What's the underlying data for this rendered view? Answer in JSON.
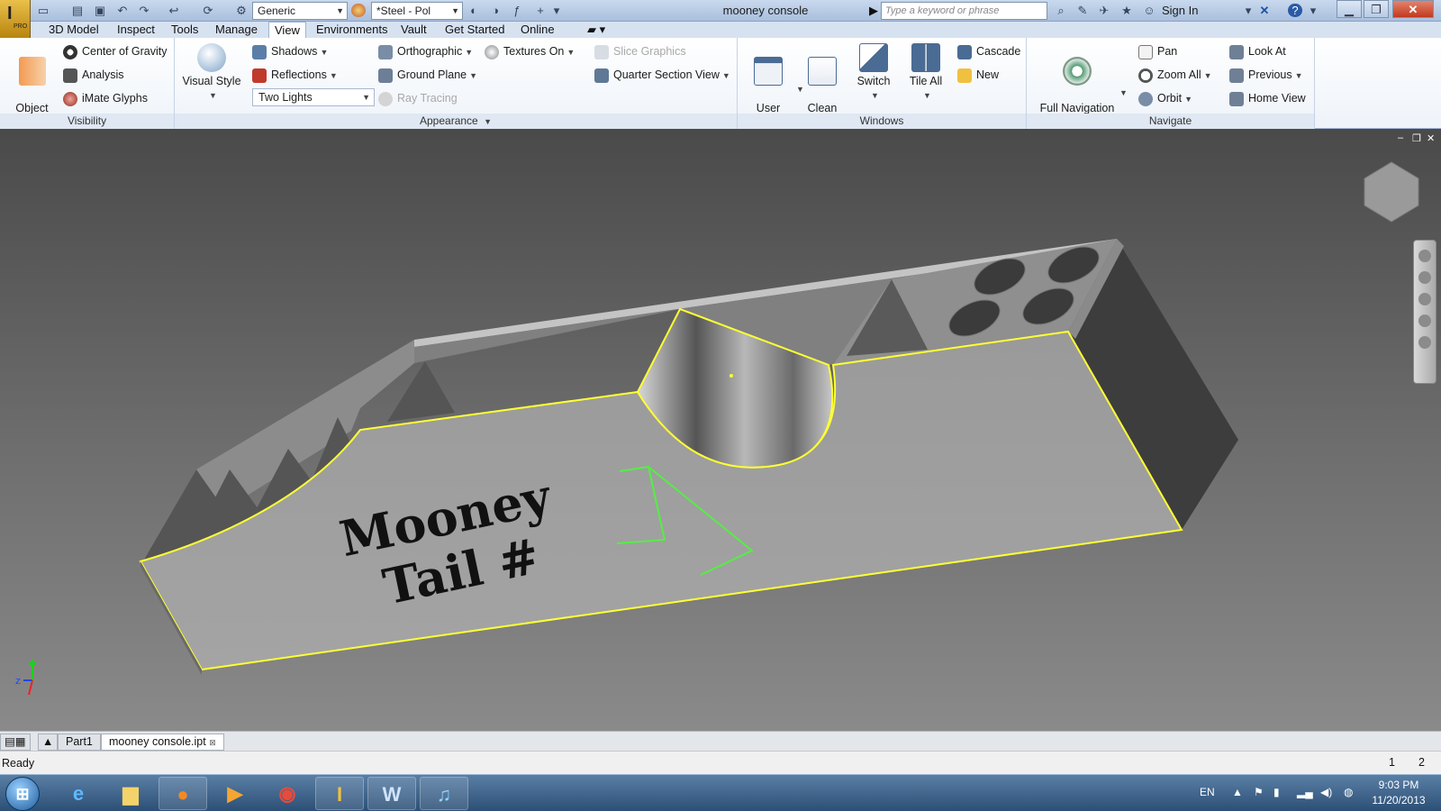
{
  "titlebar": {
    "style_combo": "Generic",
    "material_combo": "*Steel - Pol",
    "doc_title": "mooney console",
    "search_placeholder": "Type a keyword or phrase",
    "sign_in": "Sign In",
    "app_badge": "PRO"
  },
  "menu_tabs": [
    {
      "label": "3D Model"
    },
    {
      "label": "Inspect"
    },
    {
      "label": "Tools"
    },
    {
      "label": "Manage"
    },
    {
      "label": "View"
    },
    {
      "label": "Environments"
    },
    {
      "label": "Vault"
    },
    {
      "label": "Get Started"
    },
    {
      "label": "Online"
    }
  ],
  "ribbon": {
    "visibility": {
      "label": "Visibility",
      "object_visibility": "Object\nVisibility",
      "center_of_gravity": "Center of Gravity",
      "analysis": "Analysis",
      "imate_glyphs": "iMate Glyphs"
    },
    "appearance": {
      "label": "Appearance",
      "visual_style": "Visual Style",
      "shadows": "Shadows",
      "reflections": "Reflections",
      "lighting": "Two Lights",
      "orthographic": "Orthographic",
      "ground_plane": "Ground Plane",
      "ray_tracing": "Ray Tracing",
      "textures_on": "Textures On",
      "slice_graphics": "Slice Graphics",
      "quarter_section_view": "Quarter Section View"
    },
    "windows": {
      "label": "Windows",
      "user_interface": "User\nInterface",
      "clean_screen": "Clean\nScreen",
      "switch": "Switch",
      "tile_all": "Tile All",
      "cascade": "Cascade",
      "new": "New"
    },
    "navigate": {
      "label": "Navigate",
      "full_navigation_wheel": "Full Navigation\nWheel",
      "pan": "Pan",
      "zoom_all": "Zoom All",
      "orbit": "Orbit",
      "look_at": "Look At",
      "previous": "Previous",
      "home_view": "Home View"
    }
  },
  "viewport": {
    "model_text_line1": "Mooney",
    "model_text_line2": "Tail #",
    "axis_z": "z"
  },
  "doc_tabs": [
    {
      "label": "Part1"
    },
    {
      "label": "mooney console.ipt"
    }
  ],
  "status": {
    "text": "Ready",
    "num1": "1",
    "num2": "2"
  },
  "taskbar": {
    "word_glyph": "W",
    "lang": "EN",
    "time": "9:03 PM",
    "date": "11/20/2013"
  },
  "colors": {
    "edge_highlight": "#ffff33",
    "sketch_line": "#55ee44",
    "ribbon_bg": "#ffffff"
  }
}
